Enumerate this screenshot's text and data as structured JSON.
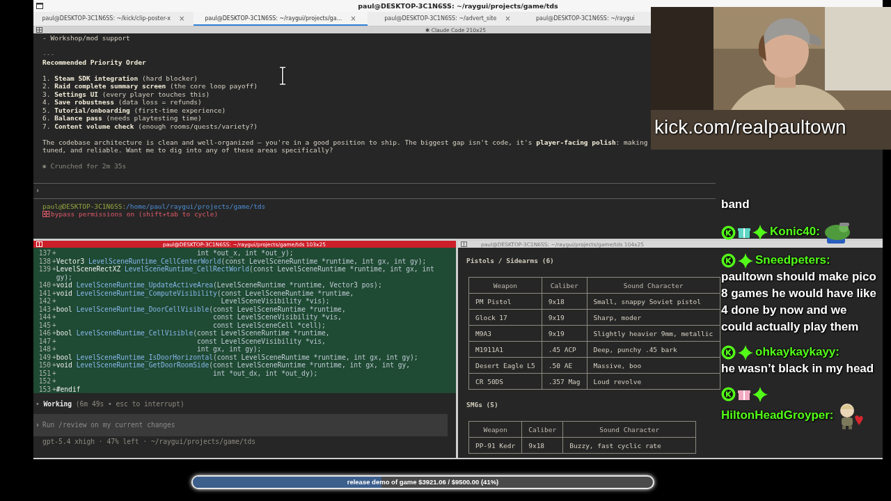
{
  "window": {
    "title": "paul@DESKTOP-3C1N6SS: ~/raygui/projects/game/tds"
  },
  "tabs": [
    {
      "label": "paul@DESKTOP-3C1N6SS: ~/kick/clip-poster-x",
      "close": "×",
      "selected": false
    },
    {
      "label": "paul@DESKTOP-3C1N6SS: ~/raygui/projects/ga...",
      "close": "×",
      "selected": true
    },
    {
      "label": "paul@DESKTOP-3C1N6SS: ~/advert_site",
      "close": "×",
      "selected": false
    },
    {
      "label": "paul@DESKTOP-3C1N6SS: ~/raygui",
      "selected": false
    }
  ],
  "top_pane": {
    "header": "✱ Claude Code 210x25",
    "lines": [
      {
        "kind": "text",
        "text": "- Workshop/mod support"
      },
      {
        "kind": "blank"
      },
      {
        "kind": "rule",
        "text": "---"
      },
      {
        "kind": "heading",
        "text": "Recommended Priority Order"
      },
      {
        "kind": "blank"
      },
      {
        "kind": "text",
        "text": "1. **Steam SDK integration** (hard blocker)"
      },
      {
        "kind": "text",
        "text": "2. **Raid complete summary screen** (the core loop payoff)"
      },
      {
        "kind": "text",
        "text": "3. **Settings UI** (every player touches this)"
      },
      {
        "kind": "text",
        "text": "4. **Save robustness** (data loss = refunds)"
      },
      {
        "kind": "text",
        "text": "5. **Tutorial/onboarding** (first-time experience)"
      },
      {
        "kind": "text",
        "text": "6. **Balance pass** (needs playtesting time)"
      },
      {
        "kind": "text",
        "text": "7. **Content volume check** (enough rooms/quests/variety?)"
      },
      {
        "kind": "blank"
      },
      {
        "kind": "text",
        "text": "The codebase architecture is clean and well-organized — you're in a good position to ship. The biggest gap isn't code, it's **player-facing polish**: making"
      },
      {
        "kind": "text",
        "text": "tuned, and reliable. Want me to dig into any of these areas specifically?"
      },
      {
        "kind": "blank"
      },
      {
        "kind": "status",
        "text": "✱ Crunched for 2m 35s"
      }
    ],
    "prompt": "›",
    "user": "paul@DESKTOP-3C1N6SS:",
    "path": "/home/paul/raygui/projects/game/tds",
    "mode": "bypass permissions on (shift+tab to cycle)"
  },
  "code_pane": {
    "header": "paul@DESKTOP-3C1N6SS: ~/raygui/projects/game/tds 103x25",
    "active": true,
    "lines": [
      {
        "num": "137",
        "marker": "+",
        "args": "                                   int *out_x, int *out_y);"
      },
      {
        "num": "138",
        "marker": "+",
        "type": "Vector3 ",
        "func": "LevelSceneRuntime_CellCenterWorld",
        "args": "(const LevelSceneRuntime *runtime, int gx, int gy);"
      },
      {
        "num": "139",
        "marker": "+",
        "type": "LevelSceneRectXZ ",
        "func": "LevelSceneRuntime_CellRectWorld",
        "args": "(const LevelSceneRuntime *runtime, int gx, int"
      },
      {
        "args": "gy);"
      },
      {
        "num": "140",
        "marker": "+",
        "type": "void ",
        "func": "LevelSceneRuntime_UpdateActiveArea",
        "args": "(LevelSceneRuntime *runtime, Vector3 pos);"
      },
      {
        "num": "141",
        "marker": "+",
        "type": "void ",
        "func": "LevelSceneRuntime_ComputeVisibility",
        "args": "(const LevelSceneRuntime *runtime,"
      },
      {
        "num": "142",
        "marker": "+",
        "args": "                                         LevelSceneVisibility *vis);"
      },
      {
        "num": "143",
        "marker": "+",
        "type": "bool ",
        "func": "LevelSceneRuntime_DoorCellVisible",
        "args": "(const LevelSceneRuntime *runtime,"
      },
      {
        "num": "144",
        "marker": "+",
        "args": "                                       const LevelSceneVisibility *vis,"
      },
      {
        "num": "145",
        "marker": "+",
        "args": "                                       const LevelSceneCell *cell);"
      },
      {
        "num": "146",
        "marker": "+",
        "type": "bool ",
        "func": "LevelSceneRuntime_CellVisible",
        "args": "(const LevelSceneRuntime *runtime,"
      },
      {
        "num": "147",
        "marker": "+",
        "args": "                                   const LevelSceneVisibility *vis,"
      },
      {
        "num": "148",
        "marker": "+",
        "args": "                                   int gx, int gy);"
      },
      {
        "num": "149",
        "marker": "+",
        "type": "bool ",
        "func": "LevelSceneRuntime_IsDoorHorizontal",
        "args": "(const LevelSceneRuntime *runtime, int gx, int gy);"
      },
      {
        "num": "150",
        "marker": "+",
        "type": "void ",
        "func": "LevelSceneRuntime_GetDoorRoomSide",
        "args": "(const LevelSceneRuntime *runtime, int gx, int gy,"
      },
      {
        "num": "151",
        "marker": "+",
        "args": "                                       int *out_dx, int *out_dy);"
      },
      {
        "num": "152",
        "marker": "+"
      },
      {
        "num": "153",
        "marker": "+",
        "type": "#endif"
      }
    ],
    "status": "• **Working** (6m 49s • esc to interrupt)",
    "input": {
      "prompt": "›",
      "placeholder": "Run /review on my current changes"
    },
    "footer": "gpt-5.4 xhigh · 47% left · ~/raygui/projects/game/tds"
  },
  "doc_pane": {
    "header": "paul@DESKTOP-3C1N6SS: ~/raygui/projects/game/tds 104x25",
    "active": false,
    "sections": [
      {
        "title": "Pistols / Sidearms (6)",
        "columns": [
          "Weapon",
          "Caliber",
          "Sound Character"
        ],
        "rows": [
          [
            "PM Pistol",
            "9x18",
            "Small, snappy Soviet pistol"
          ],
          [
            "Glock 17",
            "9x19",
            "Sharp, moder"
          ],
          [
            "M9A3",
            "9x19",
            "Slightly heavier 9mm, metallic"
          ],
          [
            "M1911A1",
            ".45 ACP",
            "Deep, punchy .45 bark"
          ],
          [
            "Desert Eagle L5",
            ".50 AE",
            "Massive, boo"
          ],
          [
            "CR 50DS",
            ".357 Mag",
            "Loud revolve"
          ]
        ]
      },
      {
        "title": "SMGs (5)",
        "columns": [
          "Weapon",
          "Caliber",
          "Sound Character"
        ],
        "rows": [
          [
            "PP-91 Kedr",
            "9x18",
            "Buzzy, fast cyclic rate"
          ]
        ]
      }
    ]
  },
  "overlay": {
    "stream_url": "kick.com/realpaultown"
  },
  "chat": {
    "messages": [
      {
        "text": "band"
      },
      {
        "badges": [
          {
            "kind": "kick"
          },
          {
            "kind": "gift",
            "color": "#5ed6c6"
          },
          {
            "kind": "sparkle"
          }
        ],
        "username": "Konic40:",
        "emote": {
          "kind": "frog"
        }
      },
      {
        "badges": [
          {
            "kind": "kick"
          },
          {
            "kind": "sparkle"
          }
        ],
        "username": "Sneedpeters:",
        "text": "paultown should make pico 8 games he would have like 4 done by now and we could actually play them"
      },
      {
        "badges": [
          {
            "kind": "kick"
          },
          {
            "kind": "sparkle"
          }
        ],
        "username": "ohkaykaykayy:",
        "text": "he wasn’t black in my head"
      },
      {
        "badges": [
          {
            "kind": "kick"
          },
          {
            "kind": "gift",
            "color": "#f2a9c2"
          },
          {
            "kind": "sparkle"
          }
        ],
        "username": "HiltonHeadGroyper:",
        "emote": {
          "kind": "figure"
        }
      }
    ]
  },
  "goal": {
    "label": "release demo of game $3921.06 / $9500.00 (41%)",
    "level": 0.41
  }
}
